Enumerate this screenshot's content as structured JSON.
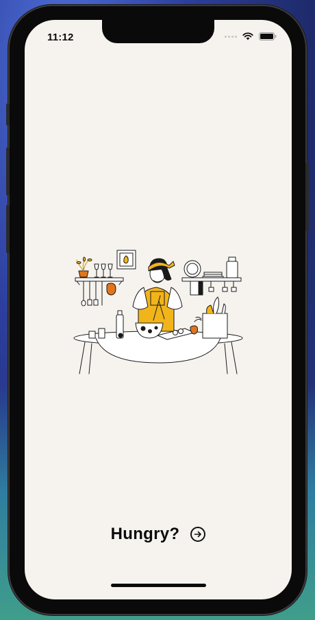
{
  "status_bar": {
    "time": "11:12"
  },
  "intro": {
    "title": "Hungry?"
  },
  "icons": {
    "wifi": "wifi-icon",
    "battery": "battery-icon",
    "next": "arrow-right-circle-icon",
    "illustration": "cooking-woman-illustration"
  },
  "colors": {
    "screen_background": "#f6f3ef",
    "accent_yellow": "#f1b41a",
    "accent_orange": "#e0751e",
    "text": "#0b0b0b"
  }
}
